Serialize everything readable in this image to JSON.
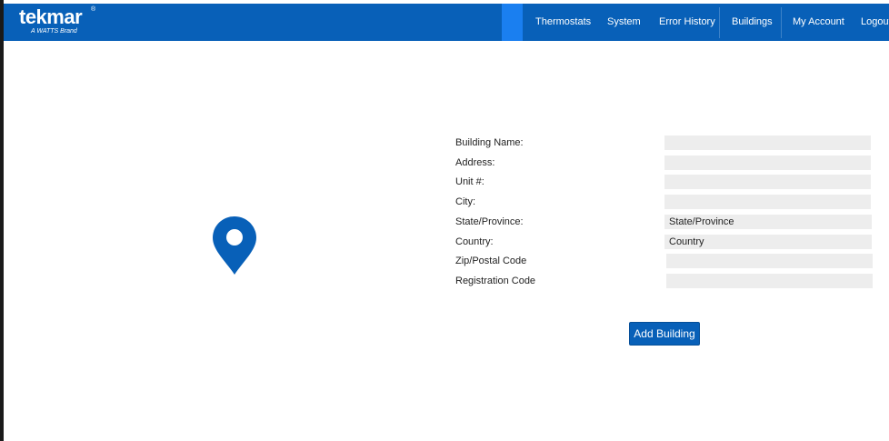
{
  "brand": {
    "name": "tekmar",
    "registered": "®",
    "tagline": "A WATTS Brand"
  },
  "nav": {
    "items": [
      {
        "label": "Thermostats"
      },
      {
        "label": "System"
      },
      {
        "label": "Error History"
      },
      {
        "label": "Buildings"
      },
      {
        "label": "My Account"
      },
      {
        "label": "Logout"
      }
    ]
  },
  "form": {
    "labels": {
      "building_name": "Building Name:",
      "address": "Address:",
      "unit": "Unit #:",
      "city": "City:",
      "state": "State/Province:",
      "country": "Country:",
      "zip": "Zip/Postal Code",
      "registration": "Registration Code"
    },
    "values": {
      "building_name": "",
      "address": "",
      "unit": "",
      "city": "",
      "state": "State/Province",
      "country": "Country",
      "zip": "",
      "registration": ""
    },
    "submit_label": "Add Building"
  },
  "icons": {
    "location": "map-pin-icon"
  },
  "colors": {
    "navbar": "#0860b8",
    "nav_active": "#1a7ff0",
    "button": "#0860b8",
    "field_bg": "#ededed"
  }
}
